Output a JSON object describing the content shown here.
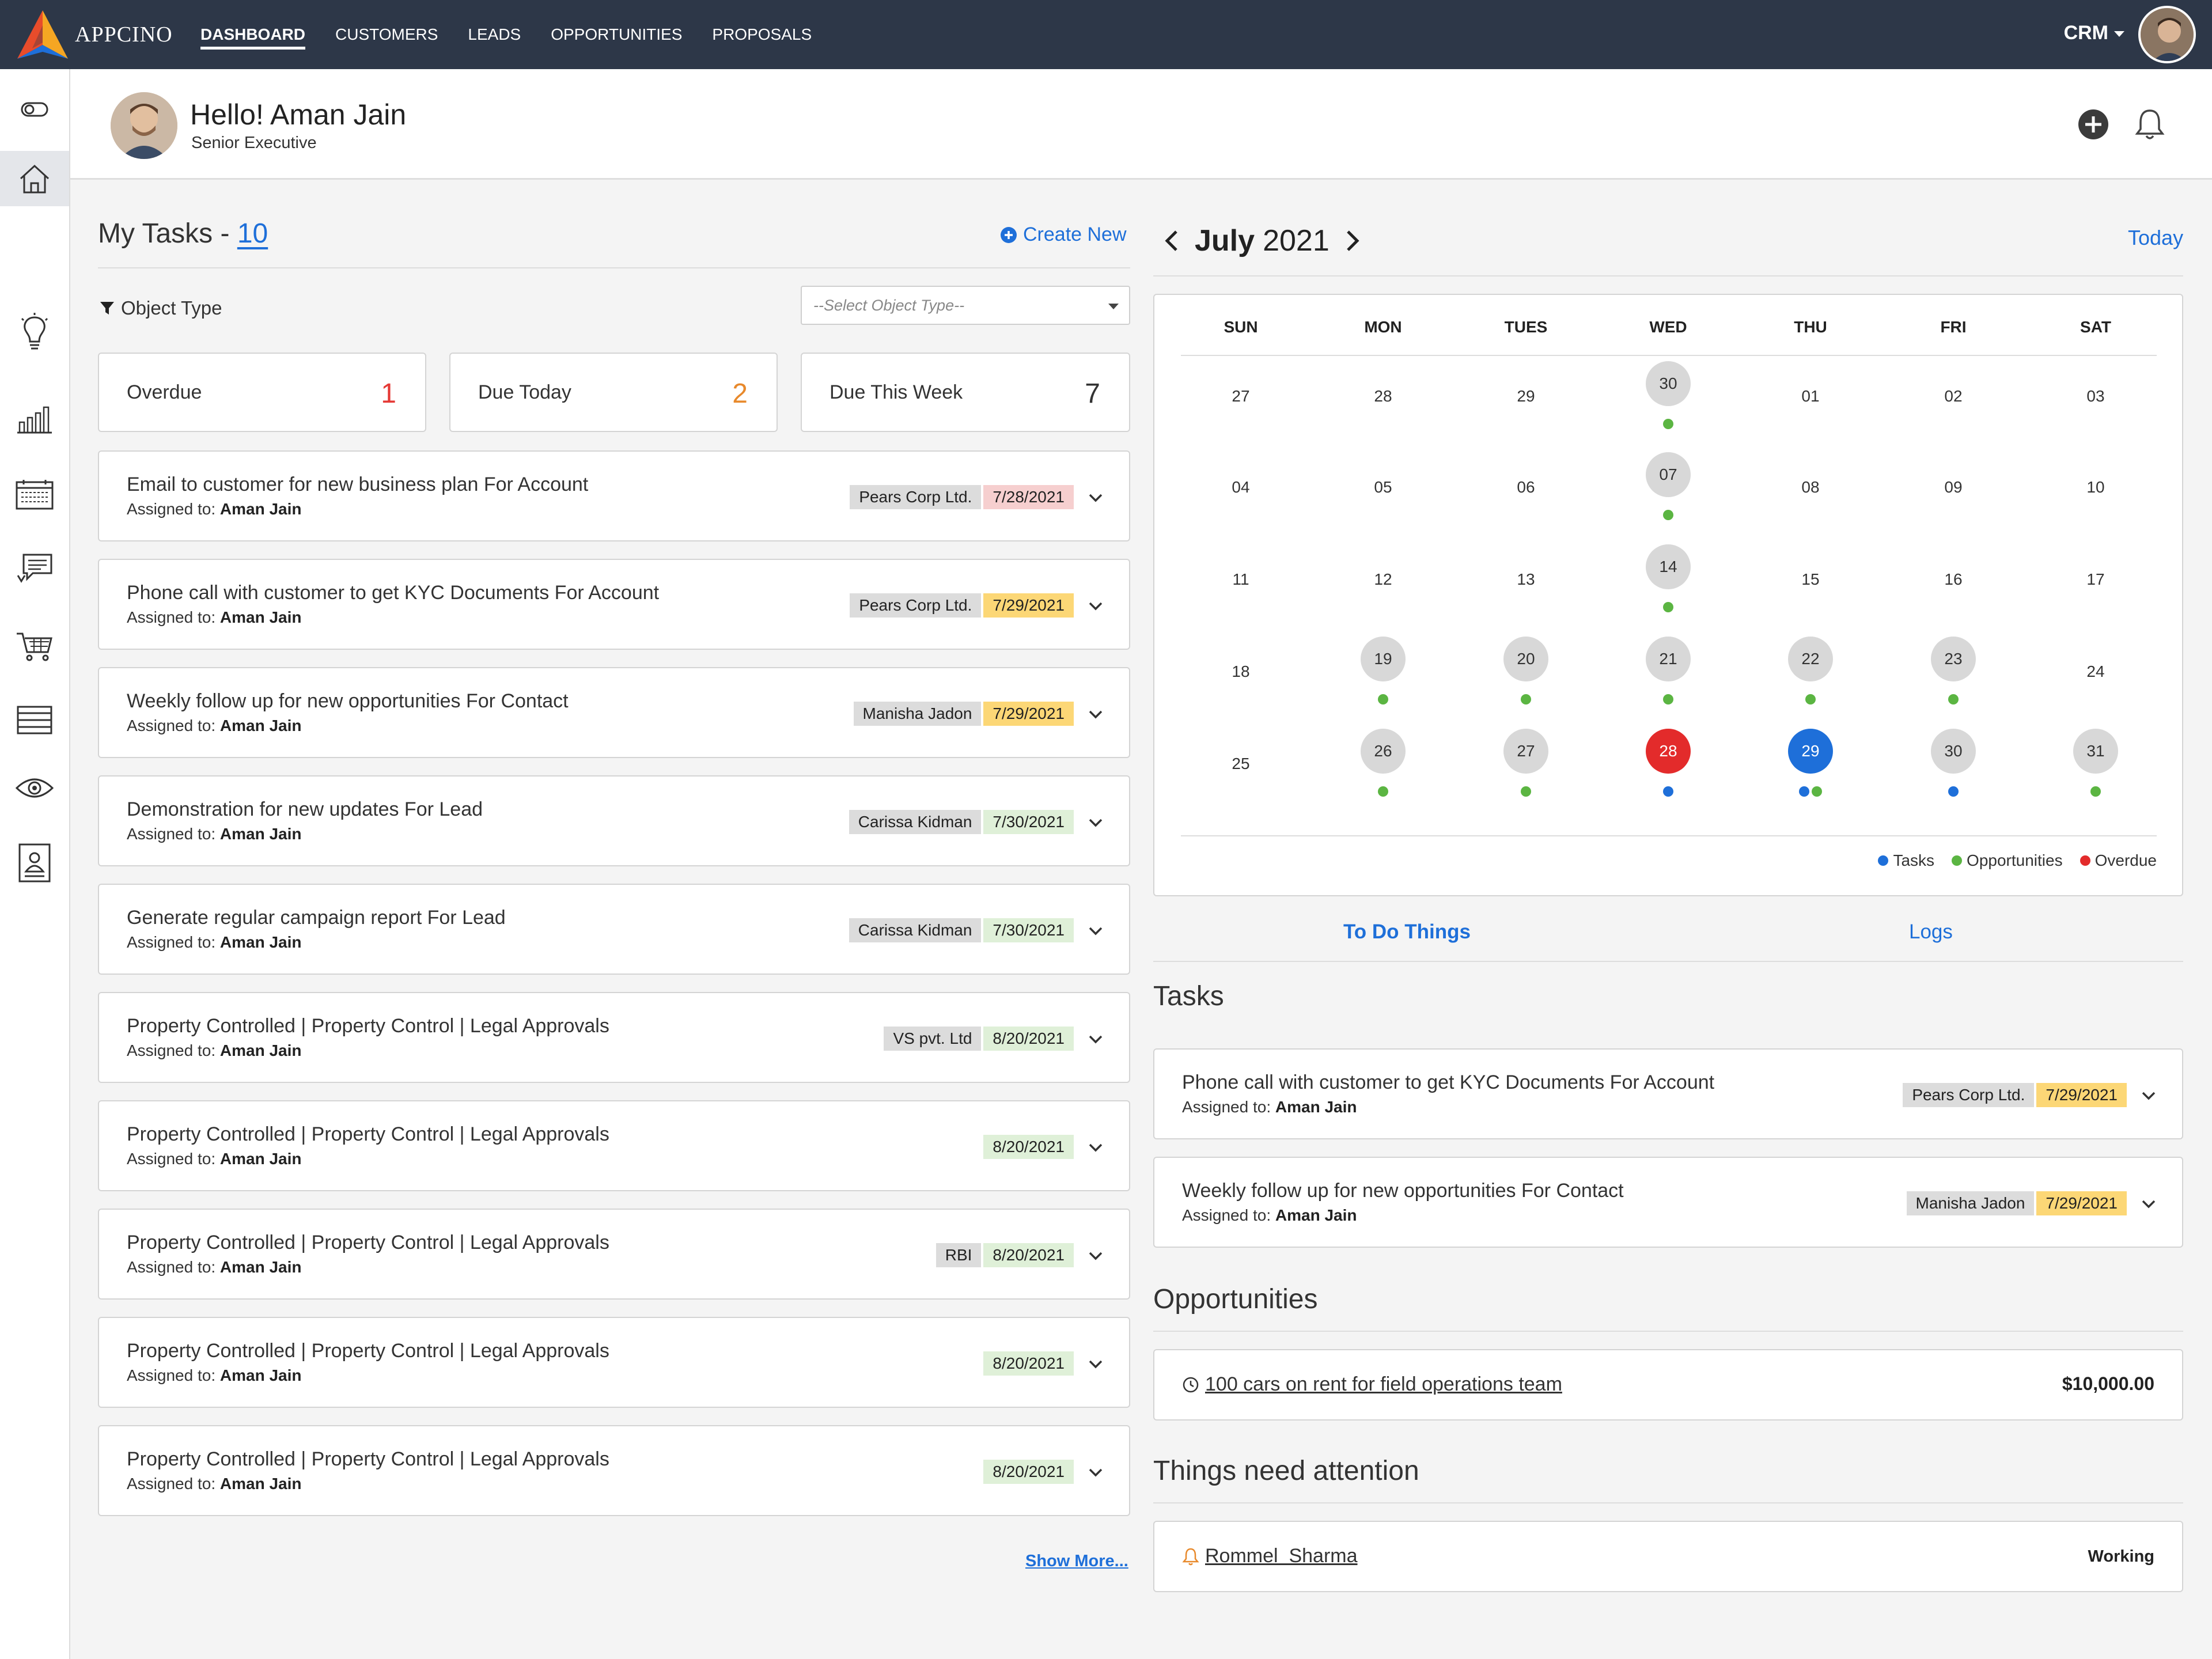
{
  "nav": {
    "brand": "APPCINO",
    "items": [
      "DASHBOARD",
      "CUSTOMERS",
      "LEADS",
      "OPPORTUNITIES",
      "PROPOSALS"
    ],
    "app_switcher": "CRM"
  },
  "header": {
    "greeting": "Hello! Aman Jain",
    "role": "Senior Executive"
  },
  "tasks": {
    "title": "My Tasks - ",
    "count": "10",
    "create_new": "Create New",
    "filter_label": "Object Type",
    "filter_placeholder": "--Select Object Type--",
    "stats": [
      {
        "label": "Overdue",
        "value": "1",
        "color": "#e53935"
      },
      {
        "label": "Due Today",
        "value": "2",
        "color": "#e8892b"
      },
      {
        "label": "Due This Week",
        "value": "7",
        "color": "#333333"
      }
    ],
    "assigned_prefix": "Assigned to: ",
    "items": [
      {
        "title": "Email to customer for new business plan For Account",
        "assignee": "Aman Jain",
        "account": "Pears Corp Ltd.",
        "date": "7/28/2021",
        "status": "red"
      },
      {
        "title": "Phone call with customer to get KYC Documents For Account",
        "assignee": "Aman Jain",
        "account": "Pears Corp Ltd.",
        "date": "7/29/2021",
        "status": "yellow"
      },
      {
        "title": "Weekly follow up for new opportunities For Contact",
        "assignee": "Aman Jain",
        "account": "Manisha Jadon",
        "date": "7/29/2021",
        "status": "yellow"
      },
      {
        "title": "Demonstration for new updates For Lead",
        "assignee": "Aman Jain",
        "account": "Carissa Kidman",
        "date": "7/30/2021",
        "status": "green"
      },
      {
        "title": "Generate regular campaign report For Lead",
        "assignee": "Aman Jain",
        "account": "Carissa Kidman",
        "date": "7/30/2021",
        "status": "green"
      },
      {
        "title": "Property Controlled | Property Control | Legal Approvals",
        "assignee": "Aman Jain",
        "account": "VS pvt. Ltd",
        "date": "8/20/2021",
        "status": "green"
      },
      {
        "title": "Property Controlled | Property Control | Legal Approvals",
        "assignee": "Aman Jain",
        "account": "",
        "date": "8/20/2021",
        "status": "green"
      },
      {
        "title": "Property Controlled | Property Control | Legal Approvals",
        "assignee": "Aman Jain",
        "account": "RBI",
        "date": "8/20/2021",
        "status": "green"
      },
      {
        "title": "Property Controlled | Property Control | Legal Approvals",
        "assignee": "Aman Jain",
        "account": "",
        "date": "8/20/2021",
        "status": "green"
      },
      {
        "title": "Property Controlled | Property Control | Legal Approvals",
        "assignee": "Aman Jain",
        "account": "",
        "date": "8/20/2021",
        "status": "green"
      }
    ],
    "show_more": "Show More..."
  },
  "calendar": {
    "month": "July",
    "year": "2021",
    "today_label": "Today",
    "weekdays": [
      "SUN",
      "MON",
      "TUES",
      "WED",
      "THU",
      "FRI",
      "SAT"
    ],
    "weeks": [
      [
        {
          "d": "27"
        },
        {
          "d": "28"
        },
        {
          "d": "29"
        },
        {
          "d": "30",
          "hl": "grey",
          "dots": [
            "g"
          ]
        },
        {
          "d": "01"
        },
        {
          "d": "02"
        },
        {
          "d": "03"
        }
      ],
      [
        {
          "d": "04"
        },
        {
          "d": "05"
        },
        {
          "d": "06"
        },
        {
          "d": "07",
          "hl": "grey",
          "dots": [
            "g"
          ]
        },
        {
          "d": "08"
        },
        {
          "d": "09"
        },
        {
          "d": "10"
        }
      ],
      [
        {
          "d": "11"
        },
        {
          "d": "12"
        },
        {
          "d": "13"
        },
        {
          "d": "14",
          "hl": "grey",
          "dots": [
            "g"
          ]
        },
        {
          "d": "15"
        },
        {
          "d": "16"
        },
        {
          "d": "17"
        }
      ],
      [
        {
          "d": "18"
        },
        {
          "d": "19",
          "hl": "grey",
          "dots": [
            "g"
          ]
        },
        {
          "d": "20",
          "hl": "grey",
          "dots": [
            "g"
          ]
        },
        {
          "d": "21",
          "hl": "grey",
          "dots": [
            "g"
          ]
        },
        {
          "d": "22",
          "hl": "grey",
          "dots": [
            "g"
          ]
        },
        {
          "d": "23",
          "hl": "grey",
          "dots": [
            "g"
          ]
        },
        {
          "d": "24"
        }
      ],
      [
        {
          "d": "25"
        },
        {
          "d": "26",
          "hl": "grey",
          "dots": [
            "g"
          ]
        },
        {
          "d": "27",
          "hl": "grey",
          "dots": [
            "g"
          ]
        },
        {
          "d": "28",
          "hl": "red",
          "dots": [
            "b"
          ]
        },
        {
          "d": "29",
          "hl": "blue",
          "dots": [
            "b",
            "g"
          ]
        },
        {
          "d": "30",
          "hl": "grey",
          "dots": [
            "b"
          ]
        },
        {
          "d": "31",
          "hl": "grey",
          "dots": [
            "g"
          ]
        }
      ]
    ],
    "legend": [
      {
        "label": "Tasks",
        "color": "#1e6fd9"
      },
      {
        "label": "Opportunities",
        "color": "#5bb542"
      },
      {
        "label": "Overdue",
        "color": "#e32b2b"
      }
    ]
  },
  "right_tabs": [
    "To Do Things",
    "Logs"
  ],
  "right_tasks": {
    "title": "Tasks",
    "items": [
      {
        "title": "Phone call with customer to get KYC Documents For Account",
        "assignee": "Aman Jain",
        "account": "Pears Corp Ltd.",
        "date": "7/29/2021",
        "status": "yellow"
      },
      {
        "title": "Weekly follow up for new opportunities For Contact",
        "assignee": "Aman Jain",
        "account": "Manisha Jadon",
        "date": "7/29/2021",
        "status": "yellow"
      }
    ]
  },
  "opportunities": {
    "title": "Opportunities",
    "item": {
      "name": "100 cars on rent for field operations team",
      "amount": "$10,000.00"
    }
  },
  "attention": {
    "title": "Things need attention",
    "item": {
      "name": "Rommel  Sharma",
      "status": "Working"
    }
  }
}
